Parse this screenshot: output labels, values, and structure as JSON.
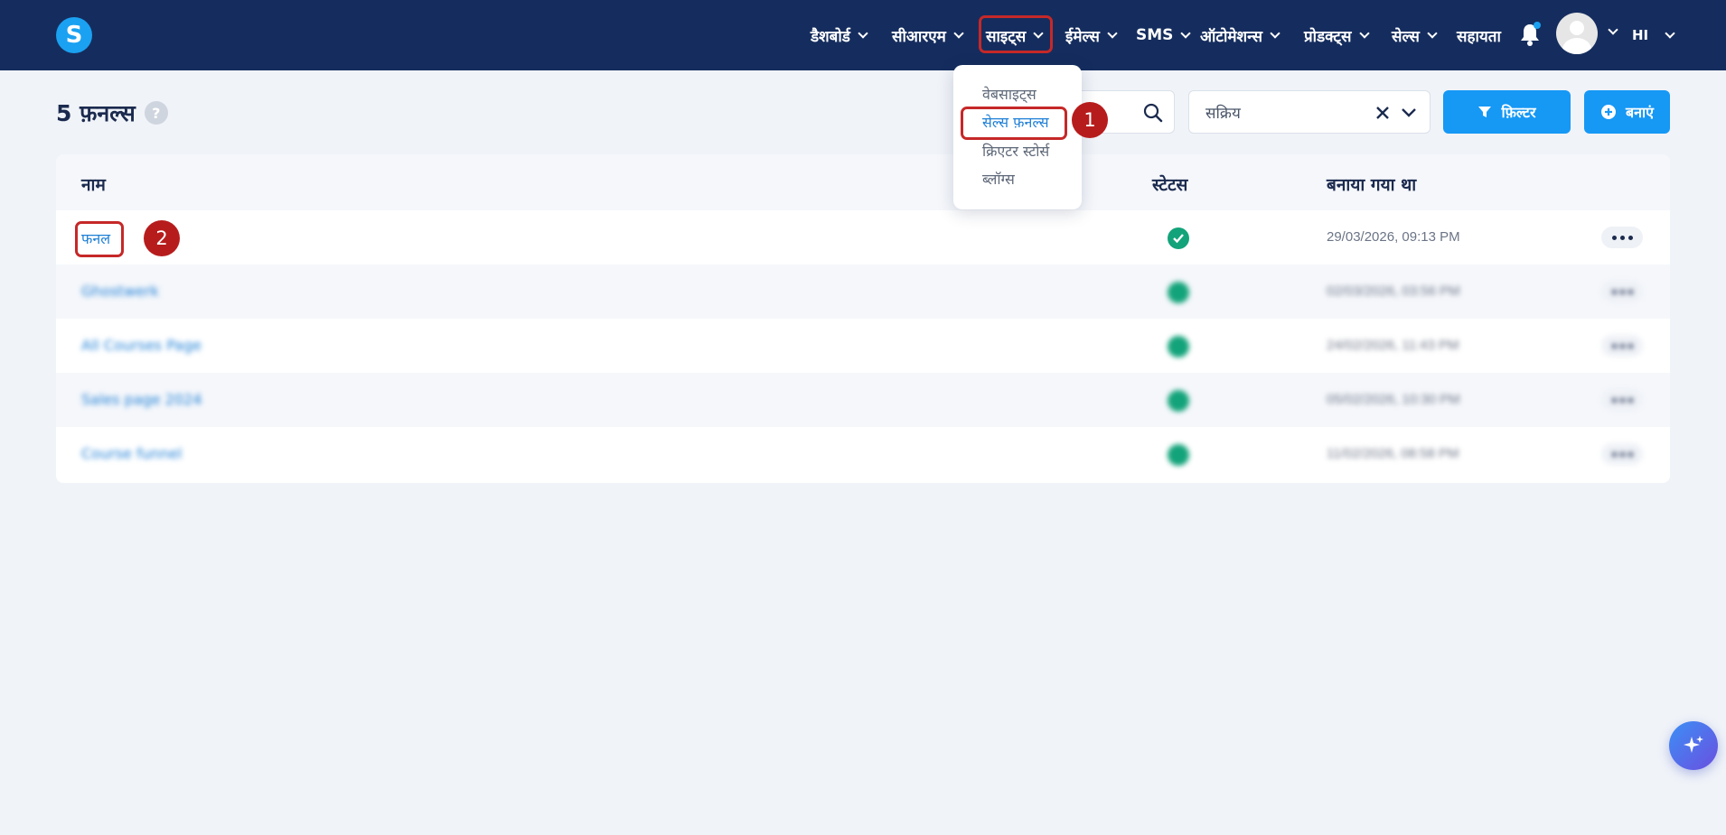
{
  "logo": {
    "letter": "S"
  },
  "nav": {
    "items": [
      {
        "label": "डैशबोर्ड"
      },
      {
        "label": "सीआरएम"
      },
      {
        "label": "साइट्स"
      },
      {
        "label": "ईमेल्स"
      },
      {
        "label": "SMS"
      },
      {
        "label": "ऑटोमेशन्स"
      },
      {
        "label": "प्रोडक्ट्स"
      },
      {
        "label": "सेल्स"
      },
      {
        "label": "सहायता"
      }
    ],
    "language": "HI"
  },
  "sites_menu": {
    "items": [
      {
        "label": "वेबसाइट्स"
      },
      {
        "label": "सेल्स फ़नल्स"
      },
      {
        "label": "क्रिएटर स्टोर्स"
      },
      {
        "label": "ब्लॉग्स"
      }
    ],
    "active_index": 1
  },
  "annotations": {
    "badge1": "1",
    "badge2": "2"
  },
  "page": {
    "title": "5 फ़नल्स",
    "help": "?"
  },
  "filters": {
    "status_value": "सक्रिय",
    "filter_label": "फ़िल्टर",
    "create_label": "बनाएं"
  },
  "table": {
    "headers": {
      "name": "नाम",
      "status": "स्टेटस",
      "created": "बनाया गया था"
    },
    "rows": [
      {
        "name": "फनल",
        "date": "29/03/2026, 09:13 PM"
      },
      {
        "name": "Ghostwerk",
        "date": "02/03/2026, 03:56 PM"
      },
      {
        "name": "All Courses Page",
        "date": "24/02/2026, 11:43 PM"
      },
      {
        "name": "Sales page 2024",
        "date": "05/02/2026, 10:30 PM"
      },
      {
        "name": "Course funnel",
        "date": "11/02/2026, 08:58 PM"
      }
    ]
  },
  "colors": {
    "topbar": "#152d5e",
    "accent": "#1698f5",
    "status_ok": "#13a37a",
    "highlight": "#c62828"
  },
  "icons": {
    "search": "search-icon",
    "bell": "bell-icon",
    "clear": "close-icon",
    "filter": "filter-icon",
    "create": "plus-circle-icon",
    "ai": "sparkle-icon"
  }
}
